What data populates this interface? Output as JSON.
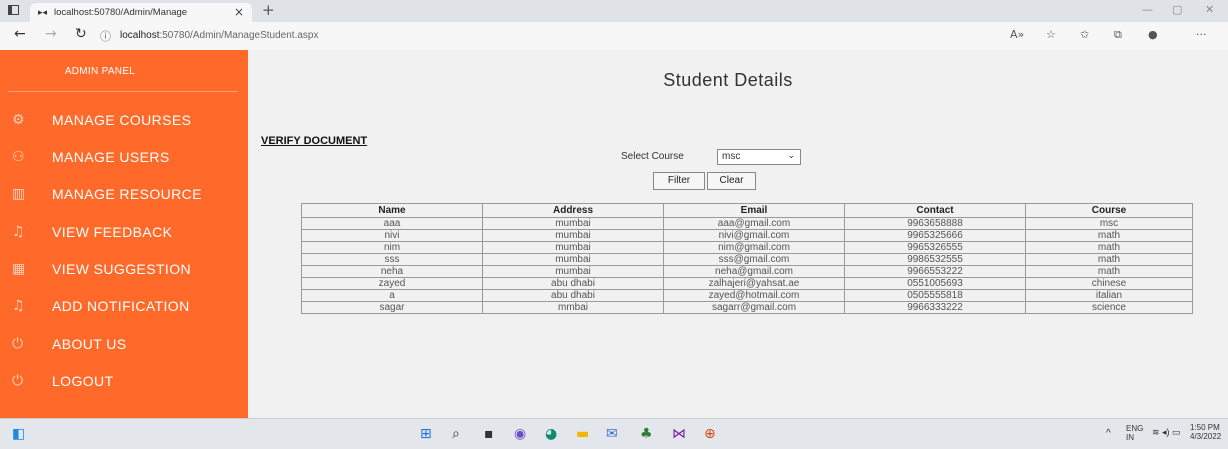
{
  "browser": {
    "tab_title": "localhost:50780/Admin/Manage",
    "url_host": "localhost",
    "url_rest": ":50780/Admin/ManageStudent.aspx"
  },
  "sidebar": {
    "header": "ADMIN PANEL",
    "items": [
      {
        "label": "MANAGE COURSES",
        "icon": "gear-icon",
        "glyph": "⚙"
      },
      {
        "label": "MANAGE USERS",
        "icon": "user-icon",
        "glyph": "⚇"
      },
      {
        "label": "MANAGE RESOURCE",
        "icon": "book-icon",
        "glyph": "▥"
      },
      {
        "label": "VIEW FEEDBACK",
        "icon": "bell-icon",
        "glyph": "♫"
      },
      {
        "label": "VIEW SUGGESTION",
        "icon": "grid-icon",
        "glyph": "▦"
      },
      {
        "label": "ADD NOTIFICATION",
        "icon": "bell-icon",
        "glyph": "♫"
      },
      {
        "label": "ABOUT US",
        "icon": "power-icon",
        "glyph": "⏻"
      },
      {
        "label": "LOGOUT",
        "icon": "power-icon",
        "glyph": "⏻"
      }
    ]
  },
  "main": {
    "title": "Student Details",
    "verify_link": "VERIFY DOCUMENT",
    "select_label": "Select Course",
    "select_value": "msc",
    "filter_label": "Filter",
    "clear_label": "Clear"
  },
  "table": {
    "headers": [
      "Name",
      "Address",
      "Email",
      "Contact",
      "Course"
    ],
    "rows": [
      [
        "aaa",
        "mumbai",
        "aaa@gmail.com",
        "9963658888",
        "msc"
      ],
      [
        "nivi",
        "mumbai",
        "nivi@gmail.com",
        "9965325666",
        "math"
      ],
      [
        "nim",
        "mumbai",
        "nim@gmail.com",
        "9965326555",
        "math"
      ],
      [
        "sss",
        "mumbai",
        "sss@gmail.com",
        "9986532555",
        "math"
      ],
      [
        "neha",
        "mumbai",
        "neha@gmail.com",
        "9966553222",
        "math"
      ],
      [
        "zayed",
        "abu dhabi",
        "zalhajeri@yahsat.ae",
        "0551005693",
        "chinese"
      ],
      [
        "a",
        "abu dhabi",
        "zayed@hotmail.com",
        "0505555818",
        "italian"
      ],
      [
        "sagar",
        "mmbai",
        "sagarr@gmail.com",
        "9966333222",
        "science"
      ]
    ]
  },
  "taskbar": {
    "lang": "ENG",
    "lang_sub": "IN",
    "time": "1:50 PM",
    "date": "4/3/2022"
  },
  "colors": {
    "sidebar": "#ff6a2a",
    "main_bg": "#f1f1f1"
  }
}
